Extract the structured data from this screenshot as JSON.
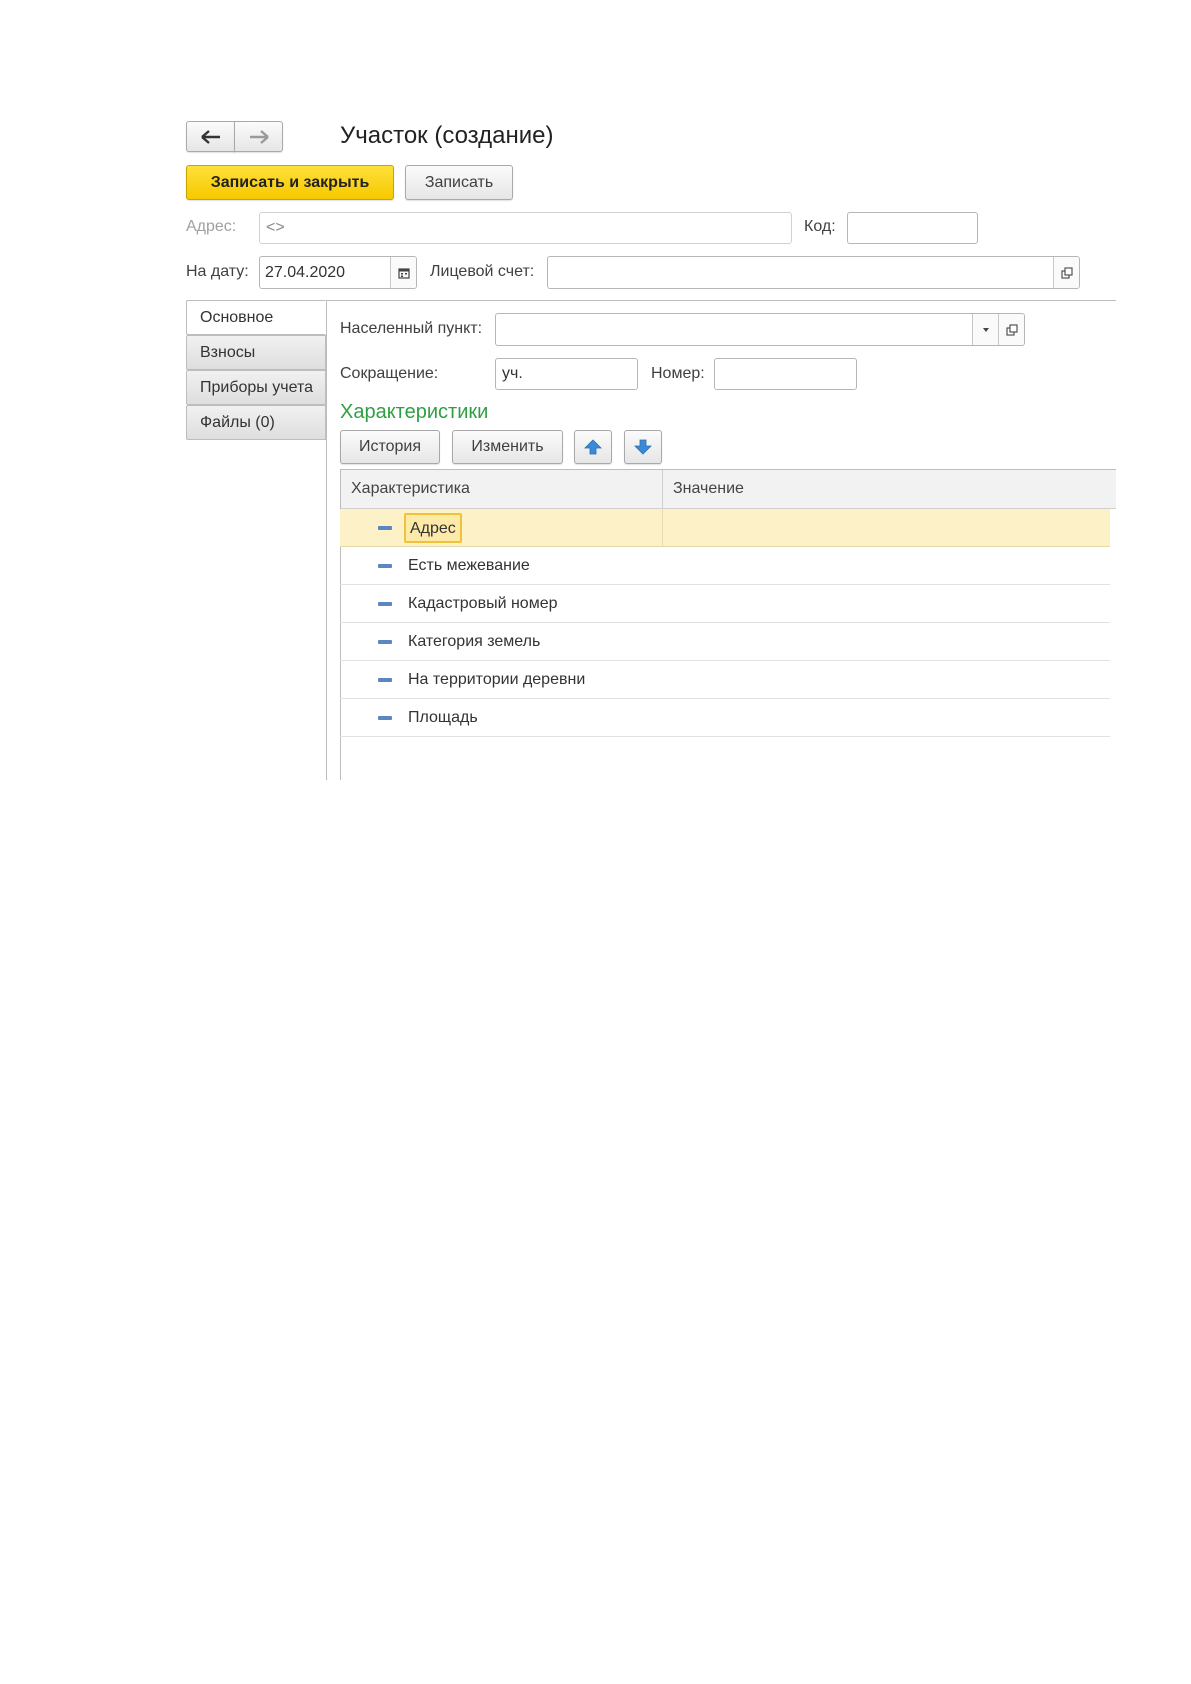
{
  "window": {
    "title": "Участок (создание)"
  },
  "toolbar": {
    "save_close_label": "Записать и закрыть",
    "save_label": "Записать"
  },
  "header": {
    "address_label": "Адрес:",
    "address_value": "<>",
    "code_label": "Код:",
    "code_value": "",
    "date_label": "На дату:",
    "date_value": "27.04.2020",
    "account_label": "Лицевой счет:",
    "account_value": ""
  },
  "tabs": [
    {
      "label": "Основное",
      "active": true
    },
    {
      "label": "Взносы",
      "active": false
    },
    {
      "label": "Приборы учета",
      "active": false
    },
    {
      "label": "Файлы (0)",
      "active": false
    }
  ],
  "main": {
    "locality_label": "Населенный пункт:",
    "locality_value": "",
    "abbr_label": "Сокращение:",
    "abbr_value": "уч.",
    "number_label": "Номер:",
    "number_value": "",
    "section_title": "Характеристики",
    "history_label": "История",
    "change_label": "Изменить"
  },
  "table": {
    "columns": [
      "Характеристика",
      "Значение"
    ],
    "rows": [
      {
        "name": "Адрес",
        "value": "",
        "selected": true
      },
      {
        "name": "Есть межевание",
        "value": ""
      },
      {
        "name": "Кадастровый номер",
        "value": ""
      },
      {
        "name": "Категория земель",
        "value": ""
      },
      {
        "name": "На территории деревни",
        "value": ""
      },
      {
        "name": "Площадь",
        "value": ""
      }
    ]
  },
  "colors": {
    "primary_button": "#f6c800",
    "section_title": "#2ea043",
    "selected_row": "#fdf1c7",
    "row_icon": "#5a87c0",
    "arrow_button": "#3b8ad8"
  },
  "icons": [
    "back-arrow-icon",
    "forward-arrow-icon",
    "calendar-icon",
    "open-icon",
    "dropdown-icon",
    "move-up-icon",
    "move-down-icon",
    "row-item-icon"
  ]
}
